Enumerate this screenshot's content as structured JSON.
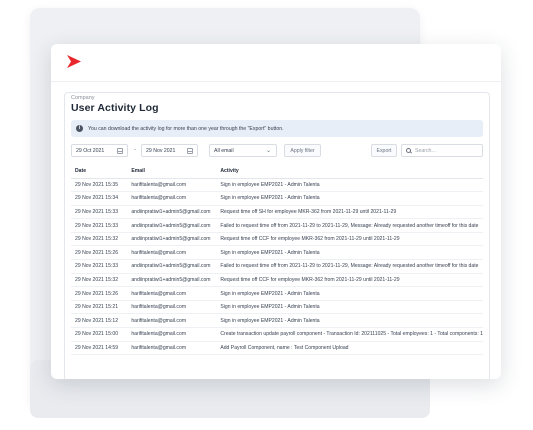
{
  "header": {
    "company": "Company",
    "title": "User Activity Log"
  },
  "info": {
    "text": "You can download the activity log for more than one year through the \"Export\" button."
  },
  "filters": {
    "start_date": "29 Oct 2021",
    "separator": "-",
    "end_date": "29 Nov 2021",
    "email_select": "All email",
    "apply_label": "Apply filter",
    "export_label": "Export",
    "search_placeholder": "Search..."
  },
  "table": {
    "columns": [
      "Date",
      "Email",
      "Activity"
    ],
    "rows": [
      [
        "29 Nov 2021 15:35",
        "harifitalenta@gmail.com",
        "Sign in employee EMP2021 - Admin Talenta"
      ],
      [
        "29 Nov 2021 15:34",
        "harifitalenta@gmail.com",
        "Sign in employee EMP2021 - Admin Talenta"
      ],
      [
        "29 Nov 2021 15:33",
        "andiinpratiwi1+admin5@gmail.com",
        "Request time off SH for employee MKR-362 from 2021-11-29 until 2021-11-29"
      ],
      [
        "29 Nov 2021 15:33",
        "andiinpratiwi1+admin5@gmail.com",
        "Failed to request time off from 2021-11-29 to 2021-11-29, Message: Already requested another timeoff for this date"
      ],
      [
        "29 Nov 2021 15:32",
        "andiinpratiwi1+admin5@gmail.com",
        "Request time off CCF for employee MKR-362 from 2021-11-29 until 2021-11-29"
      ],
      [
        "29 Nov 2021 15:26",
        "harifitalenta@gmail.com",
        "Sign in employee EMP2021 - Admin Talenta"
      ],
      [
        "29 Nov 2021 15:33",
        "andiinpratiwi1+admin5@gmail.com",
        "Failed to request time off from 2021-11-29 to 2021-11-29, Message: Already requested another timeoff for this date"
      ],
      [
        "29 Nov 2021 15:32",
        "andiinpratiwi1+admin5@gmail.com",
        "Request time off CCF for employee MKR-362 from 2021-11-29 until 2021-11-29"
      ],
      [
        "29 Nov 2021 15:26",
        "harifitalenta@gmail.com",
        "Sign in employee EMP2021 - Admin Talenta"
      ],
      [
        "29 Nov 2021 15:21",
        "harifitalenta@gmail.com",
        "Sign in employee EMP2021 - Admin Talenta"
      ],
      [
        "29 Nov 2021 15:12",
        "harifitalenta@gmail.com",
        "Sign in employee EMP2021 - Admin Talenta"
      ],
      [
        "29 Nov 2021 15:00",
        "harifitalenta@gmail.com",
        "Create transaction update payroll component - Transaction Id: 202111025 - Total employees: 1 - Total components: 1"
      ],
      [
        "29 Nov 2021 14:59",
        "harifitalenta@gmail.com",
        "Add Payroll Component, name : Test Component Upload"
      ]
    ]
  },
  "colors": {
    "brand": "#e8262e",
    "info_bg": "#e8eef8"
  }
}
